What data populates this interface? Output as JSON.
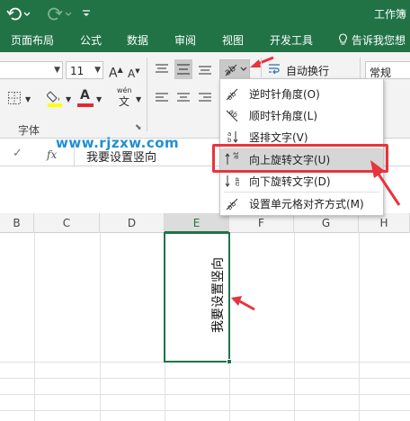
{
  "titlebar": {
    "undo_icon": "undo-icon",
    "redo_icon": "redo-icon",
    "window_title": "工作簿"
  },
  "tabs": [
    "页面布局",
    "公式",
    "数据",
    "审阅",
    "视图",
    "开发工具"
  ],
  "tell_me": "告诉我您想",
  "ribbon": {
    "font_size_value": "11",
    "number_format_value": "常规",
    "wrap_text_label": "自动换行",
    "font_group_label": "字体"
  },
  "formula_bar": {
    "fx_label": "fx",
    "content": "我要设置竖向"
  },
  "watermark": "www.rjzxw.com",
  "columns": [
    "B",
    "C",
    "D",
    "E",
    "F",
    "G",
    "H"
  ],
  "active_column": "E",
  "cell_text": "我要设置竖向",
  "orientation_menu": {
    "items": [
      {
        "label": "逆时针角度(O)",
        "icon": "counterclockwise-angle-icon"
      },
      {
        "label": "顺时针角度(L)",
        "icon": "clockwise-angle-icon"
      },
      {
        "label": "竖排文字(V)",
        "icon": "vertical-text-icon"
      },
      {
        "label": "向上旋转文字(U)",
        "icon": "rotate-text-up-icon"
      },
      {
        "label": "向下旋转文字(D)",
        "icon": "rotate-text-down-icon"
      },
      {
        "label": "设置单元格对齐方式(M)",
        "icon": "format-cell-alignment-icon"
      }
    ],
    "highlighted_index": 3
  },
  "colors": {
    "excel_green": "#217346",
    "annotation_red": "#e8343d",
    "watermark_blue": "#1f8fd6"
  }
}
